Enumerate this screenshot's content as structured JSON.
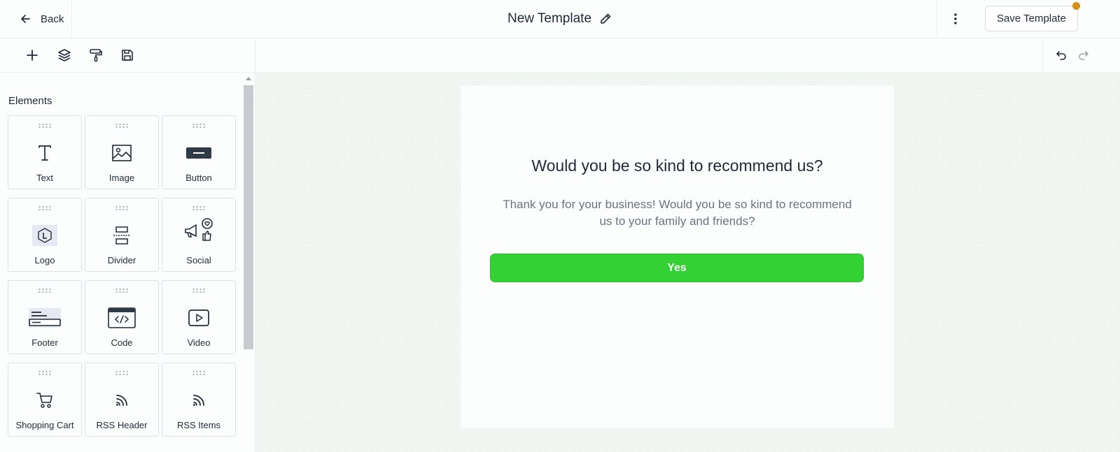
{
  "header": {
    "back_label": "Back",
    "title": "New Template",
    "save_label": "Save Template",
    "save_indicator_color": "#d98d12"
  },
  "toolbar": {
    "tools": [
      "add-icon",
      "layers-icon",
      "paint-roller-icon",
      "save-icon"
    ],
    "history": [
      "undo-icon",
      "redo-icon"
    ]
  },
  "sidebar": {
    "section_label": "Elements",
    "elements": [
      {
        "label": "Text",
        "icon": "text-icon"
      },
      {
        "label": "Image",
        "icon": "image-icon"
      },
      {
        "label": "Button",
        "icon": "button-icon"
      },
      {
        "label": "Logo",
        "icon": "logo-icon"
      },
      {
        "label": "Divider",
        "icon": "divider-icon"
      },
      {
        "label": "Social",
        "icon": "social-icon"
      },
      {
        "label": "Footer",
        "icon": "footer-icon"
      },
      {
        "label": "Code",
        "icon": "code-icon"
      },
      {
        "label": "Video",
        "icon": "video-icon"
      },
      {
        "label": "Shopping Cart",
        "icon": "shopping-cart-icon"
      },
      {
        "label": "RSS Header",
        "icon": "rss-icon"
      },
      {
        "label": "RSS Items",
        "icon": "rss-icon"
      }
    ]
  },
  "canvas": {
    "heading": "Would you be so kind to recommend us?",
    "body": "Thank you for your business! Would you be so kind to recommend us to your family and friends?",
    "button_label": "Yes",
    "button_color": "#33d133"
  }
}
